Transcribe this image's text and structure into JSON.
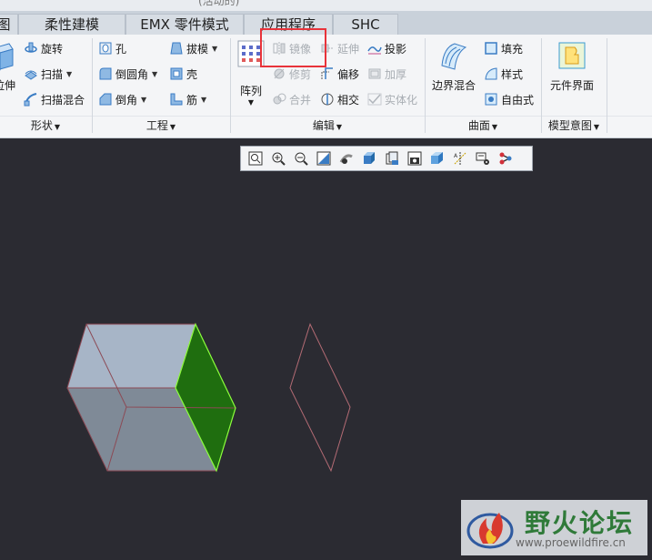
{
  "window": {
    "title_fragment": "(活动的)"
  },
  "tabs": [
    "图",
    "柔性建模",
    "EMX 零件模式",
    "应用程序",
    "SHC"
  ],
  "groups": {
    "shape": {
      "label": "形状",
      "big_label": "拉伸",
      "items": [
        "旋转",
        "扫描",
        "扫描混合"
      ]
    },
    "engineering": {
      "label": "工程",
      "col1": [
        "孔",
        "倒圆角",
        "倒角"
      ],
      "col2": [
        "拔模",
        "壳",
        "筋"
      ]
    },
    "edit": {
      "label": "编辑",
      "big_label": "阵列",
      "col1": [
        "镜像",
        "修剪",
        "合并"
      ],
      "col2": [
        "延伸",
        "偏移",
        "相交"
      ],
      "col3": [
        "投影",
        "加厚",
        "实体化"
      ]
    },
    "surface": {
      "label": "曲面",
      "big_label": "边界混合",
      "items": [
        "填充",
        "样式",
        "自由式"
      ]
    },
    "model_intent": {
      "label": "模型意图",
      "big_label": "元件界面"
    }
  },
  "view_toolbar": {
    "icons": [
      "zoom-fit-icon",
      "zoom-in-icon",
      "zoom-out-icon",
      "repaint-icon",
      "spin-center-icon",
      "display-style-icon",
      "saved-views-icon",
      "camera-icon",
      "view-manager-icon",
      "datum-display-icon",
      "annotation-display-icon",
      "connect-icon"
    ]
  },
  "colors": {
    "canvas": "#2b2b32",
    "highlight_face": "#1f6e0f",
    "highlight_edge": "#8cff3c",
    "cube_top": "#a8b7c8",
    "cube_side": "#7e8997",
    "cube_edge": "#8c4a55",
    "callout": "#e8333a"
  },
  "watermark": {
    "text": "野火论坛",
    "url": "www.proewildfire.cn"
  }
}
